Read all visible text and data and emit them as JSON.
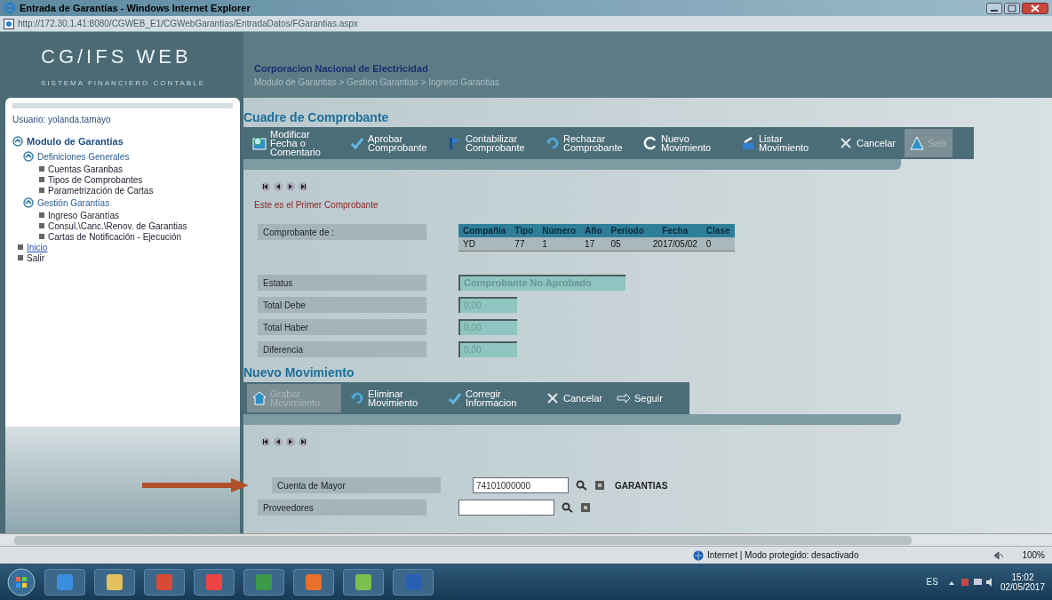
{
  "window": {
    "title": "Entrada de Garantías - Windows Internet Explorer"
  },
  "address_bar": {
    "url": "http://172.30.1.41:8080/CGWEB_E1/CGWebGarantias/EntradaDatos/FGarantias.aspx"
  },
  "app_header": {
    "logo": "CG/IFS WEB",
    "subtitle": "SISTEMA FINANCIERO CONTABLE",
    "organization": "Corporacion Nacional de Electricidad",
    "breadcrumb": "Modulo de Garantias > Gestion Garantias > Ingreso Garantias"
  },
  "sidebar": {
    "user": "Usuario: yolanda.tamayo",
    "items": [
      {
        "label": "Modulo de Garantias",
        "kind": "group",
        "expanded": true,
        "children": [
          {
            "label": "Definiciones Generales",
            "kind": "group",
            "expanded": true,
            "children": [
              {
                "label": "Cuentas Garanbas",
                "kind": "item"
              },
              {
                "label": "Tipos de Comprobantes",
                "kind": "item"
              },
              {
                "label": "Parametrización de Cartas",
                "kind": "item"
              }
            ]
          },
          {
            "label": "Gestión Garantías",
            "kind": "group",
            "expanded": true,
            "children": [
              {
                "label": "Ingreso Garantías",
                "kind": "item"
              },
              {
                "label": "Consul.\\Canc.\\Renov. de Garantias",
                "kind": "item"
              },
              {
                "label": "Cartas de Notificación - Ejecución",
                "kind": "item"
              }
            ]
          }
        ]
      },
      {
        "label": "Inicio",
        "kind": "link"
      },
      {
        "label": "Salir",
        "kind": "item"
      }
    ]
  },
  "comprobante": {
    "title": "Cuadre de Comprobante",
    "toolbar": [
      {
        "label": "Modificar Fecha o Comentario",
        "disabled": false
      },
      {
        "label": "Aprobar Comprobante",
        "disabled": false
      },
      {
        "label": "Contabilizar Comprobante",
        "disabled": false
      },
      {
        "label": "Rechazar Comprobante",
        "disabled": false
      },
      {
        "label": "Nuevo Movimiento",
        "disabled": false
      },
      {
        "label": "Listar Movimiento",
        "disabled": false
      },
      {
        "label": "Cancelar",
        "disabled": false
      },
      {
        "label": "Salir",
        "disabled": true
      }
    ],
    "message": "Este es el Primer Comprobante",
    "voucher_label": "Comprobante de :",
    "table": {
      "columns": [
        "Compañía",
        "Tipo",
        "Número",
        "Año",
        "Periodo",
        "Fecha",
        "Clase"
      ],
      "rows": [
        [
          "YD",
          "77",
          "1",
          "17",
          "05",
          "2017/05/02",
          "0"
        ]
      ]
    },
    "fields": [
      {
        "label": "Estatus",
        "value": "Comprobante No Aprobado"
      },
      {
        "label": "Total Debe",
        "value": "0,00"
      },
      {
        "label": "Total Haber",
        "value": "0,00"
      },
      {
        "label": "Diferencia",
        "value": "0,00"
      }
    ]
  },
  "movimiento": {
    "title": "Nuevo Movimiento",
    "toolbar": [
      {
        "label": "Grabar Movimiento",
        "disabled": true
      },
      {
        "label": "Eliminar Movimiento",
        "disabled": false
      },
      {
        "label": "Corregir Informacion",
        "disabled": false
      },
      {
        "label": "Cancelar",
        "disabled": false
      },
      {
        "label": "Seguir",
        "disabled": false
      }
    ],
    "fields": [
      {
        "label": "Cuenta de Mayor",
        "value": "74101000000",
        "description": "GARANTIAS",
        "highlighted": true
      },
      {
        "label": "Proveedores",
        "highlighted": false
      }
    ]
  },
  "status_bar": {
    "zone": "Internet | Modo protegido: desactivado",
    "zoom": "100%"
  },
  "taskbar": {
    "language": "ES",
    "time": "15:02",
    "date": "02/05/2017"
  }
}
